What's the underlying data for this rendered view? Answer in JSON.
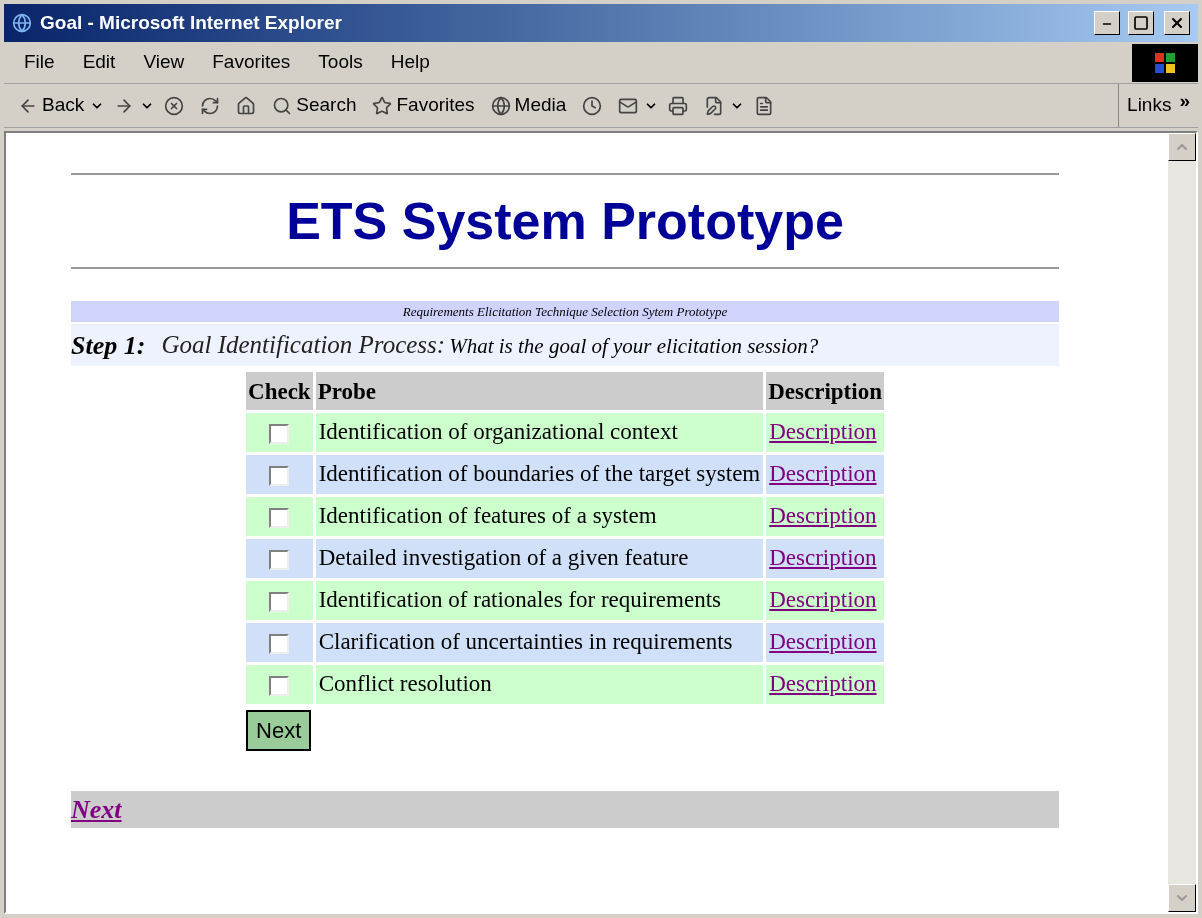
{
  "window": {
    "title": "Goal - Microsoft Internet Explorer"
  },
  "menu": [
    {
      "label": "File"
    },
    {
      "label": "Edit"
    },
    {
      "label": "View"
    },
    {
      "label": "Favorites"
    },
    {
      "label": "Tools"
    },
    {
      "label": "Help"
    }
  ],
  "toolbar": [
    {
      "kind": "back",
      "label": "Back"
    },
    {
      "kind": "forward"
    },
    {
      "kind": "stop"
    },
    {
      "kind": "refresh"
    },
    {
      "kind": "home"
    },
    {
      "kind": "search",
      "label": "Search"
    },
    {
      "kind": "favorites",
      "label": "Favorites"
    },
    {
      "kind": "media",
      "label": "Media"
    },
    {
      "kind": "history"
    },
    {
      "kind": "mail"
    },
    {
      "kind": "print"
    },
    {
      "kind": "edit"
    },
    {
      "kind": "discuss"
    }
  ],
  "links": {
    "label": "Links",
    "chevron": "»"
  },
  "page": {
    "title": "ETS System Prototype",
    "banner": "Requirements Elicitation Technique Selection Sytem Prototype",
    "step": {
      "label": "Step 1:",
      "heading": "Goal Identification Process:",
      "question": "What is the goal of your elicitation session?"
    },
    "table": {
      "columns": [
        "Check",
        "Probe",
        "Description"
      ],
      "rows": [
        {
          "checked": false,
          "probe": "Identification of organizational context",
          "link": "Description"
        },
        {
          "checked": false,
          "probe": "Identification of boundaries of the target system",
          "link": "Description"
        },
        {
          "checked": false,
          "probe": "Identification of features of a system",
          "link": "Description"
        },
        {
          "checked": false,
          "probe": "Detailed investigation of a given feature",
          "link": "Description"
        },
        {
          "checked": false,
          "probe": "Identification of rationales for requirements",
          "link": "Description"
        },
        {
          "checked": false,
          "probe": "Clarification of uncertainties in requirements",
          "link": "Description"
        },
        {
          "checked": false,
          "probe": "Conflict resolution",
          "link": "Description"
        }
      ]
    },
    "next_button": "Next",
    "footer_link": "Next"
  }
}
